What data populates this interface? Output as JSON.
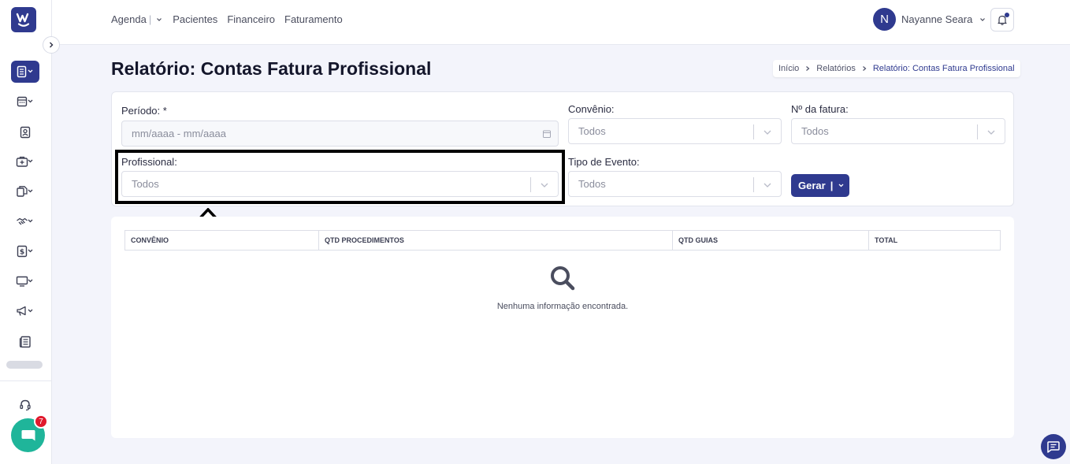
{
  "topnav": {
    "items": [
      "Agenda",
      "Pacientes",
      "Financeiro",
      "Faturamento"
    ],
    "agenda_sep": "|"
  },
  "user": {
    "initial": "N",
    "name": "Nayanne Seara"
  },
  "page": {
    "title": "Relatório: Contas Fatura Profissional"
  },
  "breadcrumb": [
    "Início",
    "Relatórios",
    "Relatório: Contas Fatura Profissional"
  ],
  "filters": {
    "periodo": {
      "label": "Período: *",
      "placeholder": "mm/aaaa - mm/aaaa"
    },
    "convenio": {
      "label": "Convênio:",
      "value": "Todos"
    },
    "fatura": {
      "label": "Nº da fatura:",
      "value": "Todos"
    },
    "profissional": {
      "label": "Profissional:",
      "value": "Todos"
    },
    "evento": {
      "label": "Tipo de Evento:",
      "value": "Todos"
    },
    "gerar_label": "Gerar",
    "gerar_sep": "|"
  },
  "table": {
    "columns": [
      "CONVÊNIO",
      "QTD PROCEDIMENTOS",
      "QTD GUIAS",
      "TOTAL"
    ],
    "empty_message": "Nenhuma informação encontrada."
  },
  "chat": {
    "badge_count": "7"
  },
  "colors": {
    "primary": "#2f3a8f",
    "chat": "#1fb59a",
    "badge": "#e0192d"
  },
  "sidebar_icons": [
    "document-list-icon",
    "calendar-icon",
    "contacts-icon",
    "medical-bag-icon",
    "documents-icon",
    "handshake-icon",
    "dollar-icon",
    "monitor-icon",
    "megaphone-icon",
    "newspaper-icon",
    "headset-icon"
  ]
}
